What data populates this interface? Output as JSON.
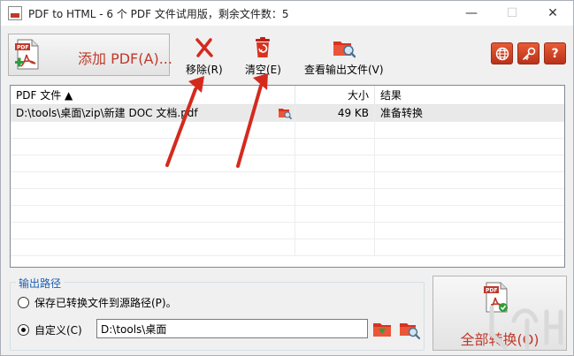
{
  "window": {
    "title": "PDF to HTML - 6 个 PDF 文件试用版，剩余文件数：5",
    "minimize": "—",
    "maximize": "☐",
    "close": "✕"
  },
  "toolbar": {
    "add_pdf": "添加 PDF(A)...",
    "remove": "移除(R)",
    "clear": "清空(E)",
    "view_output": "查看输出文件(V)",
    "icons": [
      "globe-icon",
      "key-icon",
      "help-icon"
    ],
    "help_glyph": "?"
  },
  "list": {
    "headers": {
      "name": "PDF 文件 ▲",
      "size": "大小",
      "result": "结果"
    },
    "rows": [
      {
        "name": "D:\\tools\\桌面\\zip\\新建 DOC 文档.pdf",
        "size": "49 KB",
        "result": "准备转换"
      }
    ],
    "empty_rows": 8
  },
  "output": {
    "group_title": "输出路径",
    "save_to_source": "保存已转换文件到源路径(P)。",
    "custom": "自定义(C)",
    "custom_path": "D:\\tools\\桌面",
    "selected": "custom"
  },
  "convert_all": "全部转换(O)",
  "colors": {
    "accent_red": "#c0392b",
    "group_title_blue": "#1a5fb4",
    "arrow_red": "#d42a1e"
  }
}
